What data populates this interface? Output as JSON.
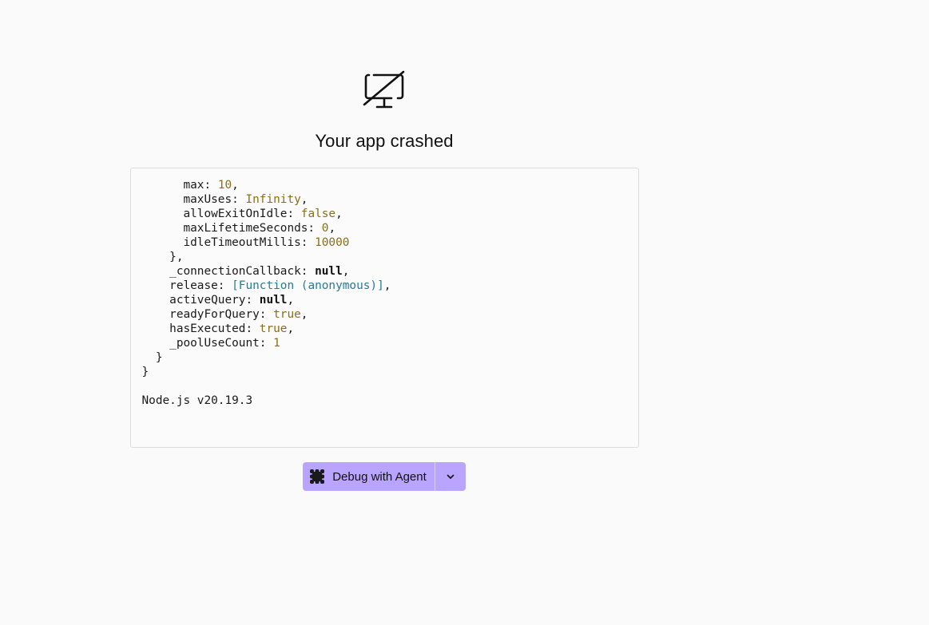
{
  "crash": {
    "title": "Your app crashed",
    "icon": "monitor-off-icon"
  },
  "log": {
    "lines": [
      [
        {
          "t": "      max: "
        },
        {
          "t": "10",
          "c": "num"
        },
        {
          "t": ","
        }
      ],
      [
        {
          "t": "      maxUses: "
        },
        {
          "t": "Infinity",
          "c": "num"
        },
        {
          "t": ","
        }
      ],
      [
        {
          "t": "      allowExitOnIdle: "
        },
        {
          "t": "false",
          "c": "num"
        },
        {
          "t": ","
        }
      ],
      [
        {
          "t": "      maxLifetimeSeconds: "
        },
        {
          "t": "0",
          "c": "num"
        },
        {
          "t": ","
        }
      ],
      [
        {
          "t": "      idleTimeoutMillis: "
        },
        {
          "t": "10000",
          "c": "num"
        }
      ],
      [
        {
          "t": "    },"
        }
      ],
      [
        {
          "t": "    _connectionCallback: "
        },
        {
          "t": "null",
          "c": "kw"
        },
        {
          "t": ","
        }
      ],
      [
        {
          "t": "    release: "
        },
        {
          "t": "[Function (anonymous)]",
          "c": "str"
        },
        {
          "t": ","
        }
      ],
      [
        {
          "t": "    activeQuery: "
        },
        {
          "t": "null",
          "c": "kw"
        },
        {
          "t": ","
        }
      ],
      [
        {
          "t": "    readyForQuery: "
        },
        {
          "t": "true",
          "c": "num"
        },
        {
          "t": ","
        }
      ],
      [
        {
          "t": "    hasExecuted: "
        },
        {
          "t": "true",
          "c": "num"
        },
        {
          "t": ","
        }
      ],
      [
        {
          "t": "    _poolUseCount: "
        },
        {
          "t": "1",
          "c": "num"
        }
      ],
      [
        {
          "t": "  }"
        }
      ],
      [
        {
          "t": "}"
        }
      ],
      [
        {
          "t": ""
        }
      ],
      [
        {
          "t": "Node.js v20.19.3"
        }
      ]
    ]
  },
  "actions": {
    "debug_label": "Debug with Agent",
    "debug_icon": "agent-icon",
    "menu_icon": "chevron-down-icon",
    "accent": "#b9a5ff"
  }
}
